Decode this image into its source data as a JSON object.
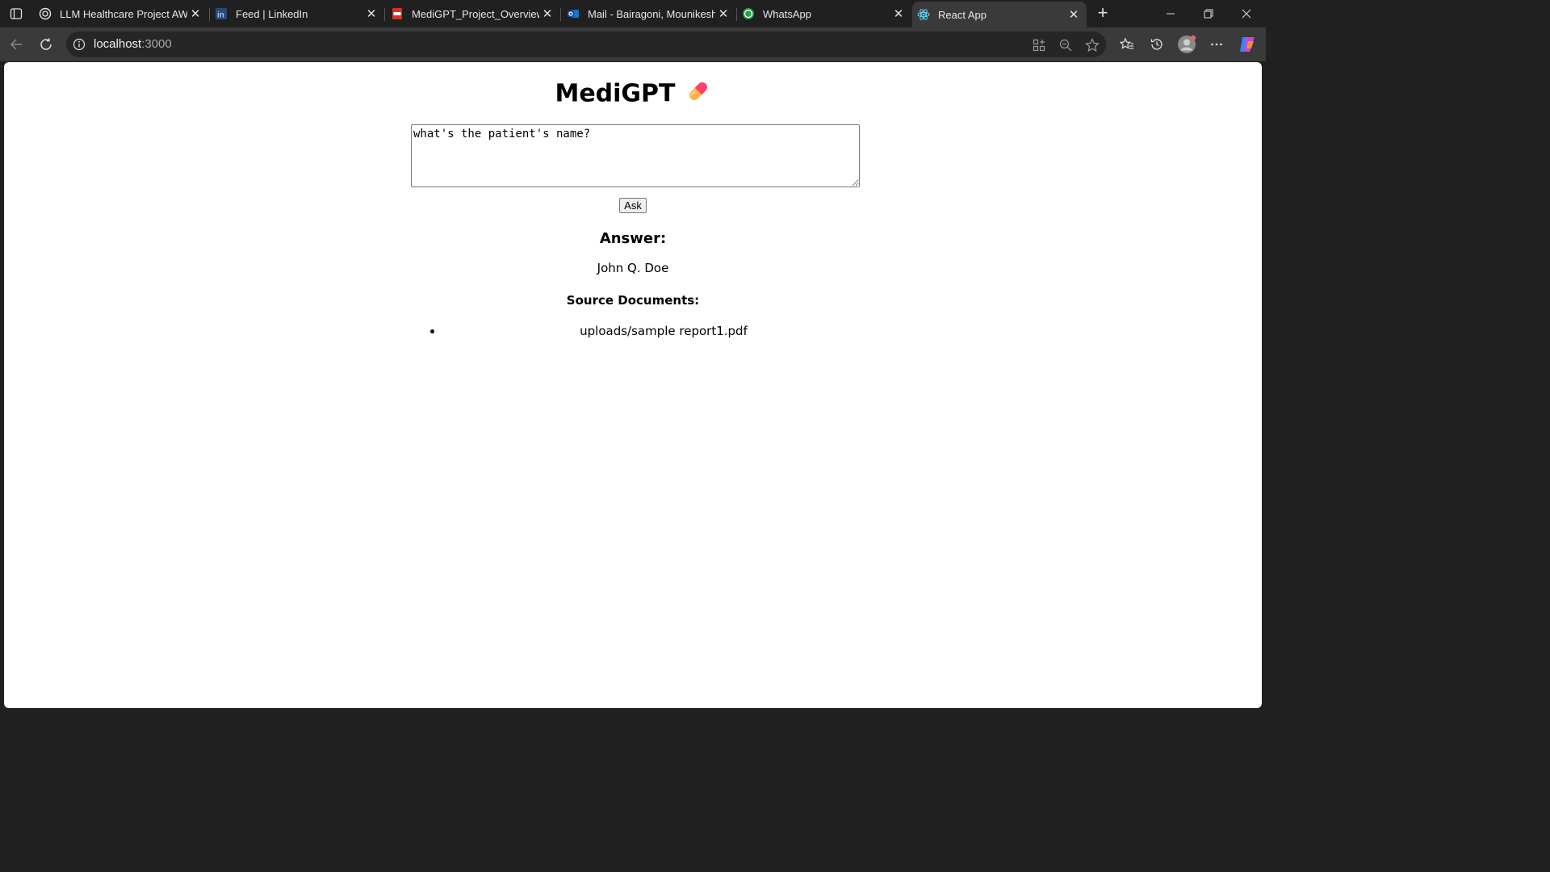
{
  "browser": {
    "tabs": [
      {
        "title": "LLM Healthcare Project AWS",
        "icon": "openai-icon",
        "active": false
      },
      {
        "title": "Feed | LinkedIn",
        "icon": "linkedin-icon",
        "active": false
      },
      {
        "title": "MediGPT_Project_Overview.p",
        "icon": "pdf-icon",
        "active": false
      },
      {
        "title": "Mail - Bairagoni, Mounikesh",
        "icon": "outlook-icon",
        "active": false
      },
      {
        "title": "WhatsApp",
        "icon": "whatsapp-icon",
        "active": false
      },
      {
        "title": "React App",
        "icon": "react-icon",
        "active": true
      }
    ],
    "address": {
      "url_host": "localhost",
      "url_port": ":3000"
    }
  },
  "app": {
    "title": "MediGPT",
    "title_icon": "pill-icon",
    "question_value": "what's the patient's name?",
    "ask_label": "Ask",
    "answer_heading": "Answer:",
    "answer_text": "John Q. Doe",
    "sources_heading": "Source Documents:",
    "sources": [
      "uploads/sample report1.pdf"
    ]
  },
  "colors": {
    "chrome_bg": "#202020",
    "toolbar_bg": "#3a3a3a",
    "omnibox_bg": "#262626",
    "page_bg": "#ffffff"
  }
}
